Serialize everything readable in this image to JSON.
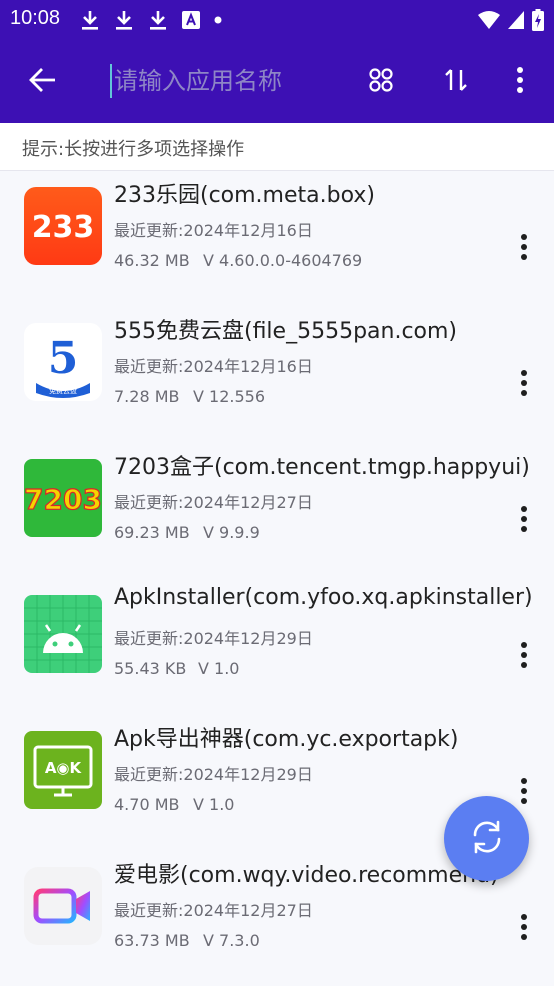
{
  "status_bar": {
    "time": "10:08",
    "icons_left": [
      "download-icon",
      "download-icon",
      "download-icon",
      "a-notification-icon",
      "dot-icon"
    ],
    "icons_right": [
      "wifi-icon",
      "signal-icon",
      "battery-charging-icon"
    ]
  },
  "toolbar": {
    "back_icon": "arrow-left-icon",
    "search_placeholder": "请输入应用名称",
    "search_value": "",
    "grid_icon": "grid-view-icon",
    "sort_icon": "sort-icon",
    "more_icon": "more-vert-icon"
  },
  "hint": "提示:长按进行多项选择操作",
  "apps": [
    {
      "name": "233乐园(com.meta.box)",
      "updated": "最近更新:2024年12月16日",
      "size": "46.32 MB",
      "version": "V 4.60.0.0-4604769",
      "icon": "233-app-icon"
    },
    {
      "name": "555免费云盘(file_5555pan.com)",
      "updated": "最近更新:2024年12月16日",
      "size": "7.28 MB",
      "version": "V 12.556",
      "icon_text": "免费云盘",
      "icon": "555-cloud-app-icon"
    },
    {
      "name": "7203盒子(com.tencent.tmgp.happyui)",
      "updated": "最近更新:2024年12月27日",
      "size": "69.23 MB",
      "version": "V 9.9.9",
      "icon": "7203-box-app-icon"
    },
    {
      "name": "ApkInstaller(com.yfoo.xq.apkinstaller)",
      "updated": "最近更新:2024年12月29日",
      "size": "55.43 KB",
      "version": "V 1.0",
      "icon": "android-app-icon"
    },
    {
      "name": "Apk导出神器(com.yc.exportapk)",
      "updated": "最近更新:2024年12月29日",
      "size": "4.70 MB",
      "version": "V 1.0",
      "icon": "apk-export-app-icon"
    },
    {
      "name": "爱电影(com.wqy.video.recommend)",
      "updated": "最近更新:2024年12月27日",
      "size": "63.73 MB",
      "version": "V 7.3.0",
      "icon": "movie-app-icon"
    }
  ],
  "fab_icon": "refresh-icon",
  "colors": {
    "primary": "#3d10b4",
    "fab": "#5b7ef2",
    "background": "#f7f8fc"
  }
}
